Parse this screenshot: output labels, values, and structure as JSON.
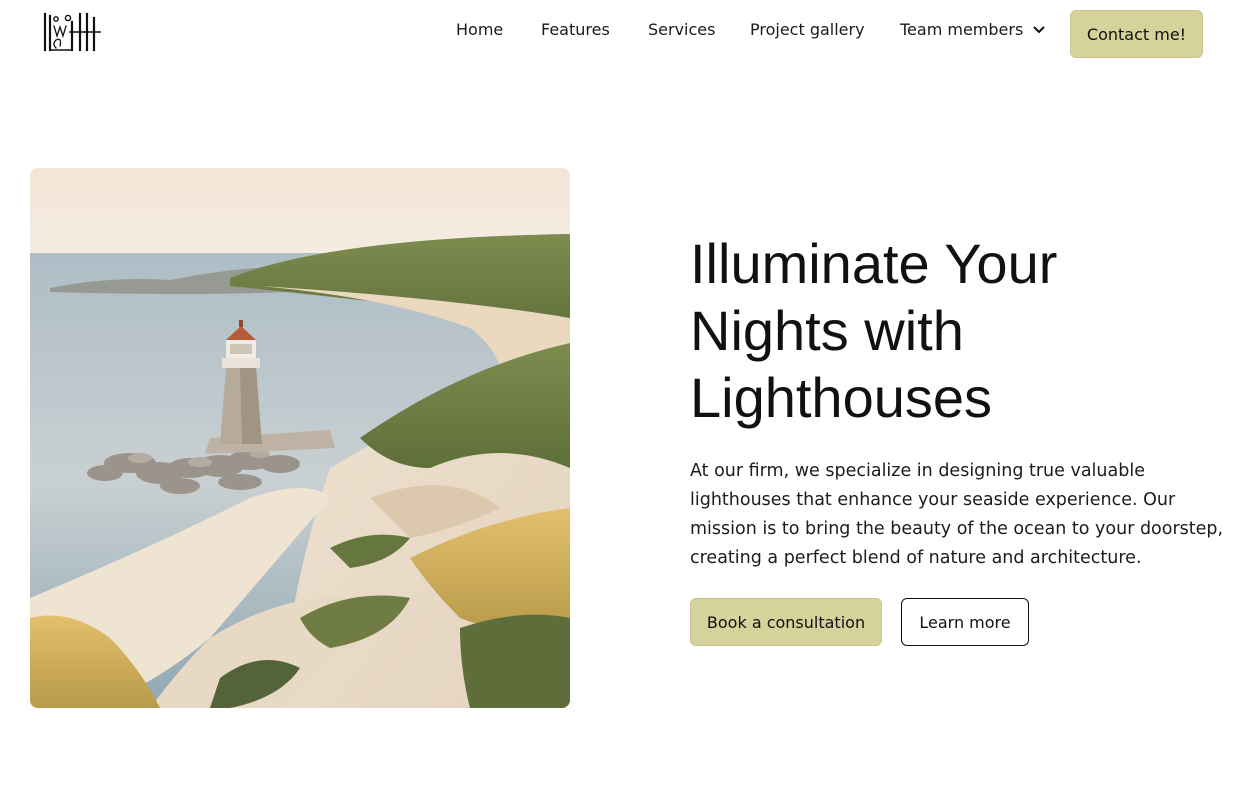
{
  "header": {
    "logo_icon": "lighthouse-monogram-logo",
    "nav": {
      "home": "Home",
      "features": "Features",
      "services": "Services",
      "project_gallery": "Project gallery",
      "team_members": "Team members"
    },
    "dropdown_icon": "chevron-down-icon",
    "contact_label": "Contact me!"
  },
  "hero": {
    "image_subject": "lighthouse on a sandy coastal dune beside the sea",
    "title_lines": [
      "Illuminate Your",
      "Nights with",
      "Lighthouses"
    ],
    "description": "At our firm, we specialize in designing true valuable lighthouses that enhance your seaside experience. Our mission is to bring the beauty of the ocean to your doorstep, creating a perfect blend of nature and architecture.",
    "primary_cta": "Book a consultation",
    "secondary_cta": "Learn more"
  },
  "colors": {
    "accent": "#d6d29c",
    "text": "#111111",
    "background": "#ffffff"
  }
}
